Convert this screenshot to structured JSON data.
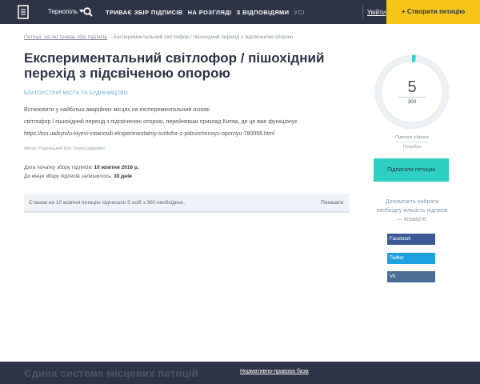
{
  "header": {
    "city": "Тернопіль",
    "nav": {
      "collecting": "ТРИВАЄ ЗБІР ПІДПИСІВ",
      "review": "НА РОЗГЛЯДІ",
      "answered": "З ВІДПОВІДЯМИ",
      "all": "УСІ"
    },
    "login": "Увійти",
    "create_petition": "+ Створити петицію"
  },
  "breadcrumb": {
    "link": "Петиції, на які триває збір підписів",
    "separator": "→",
    "current": "Експериментальний світлофор / пішохідний перехід з підсвіченою опорою"
  },
  "petition": {
    "title": "Експериментальний світлофор / пішохідний перехід з підсвіченою опорою",
    "category": "БЛАГОУСТРІЙ МІСТА ТА БУДІВНИЦТВО",
    "description_line1": "Встановити у найбільш аварійних місцях на експерементальний основі",
    "description_line2": "світлофор / пішохідний перехід з підсвіченою опорою, перейнявши приклад Києва, де це вже функціонує.",
    "description_line3": "https://tsn.ua/kyiv/u-kiyevi-vstanovili-eksperimentalniy-svitlofor-z-pidsvichenoyu-oporoyu-780058.html",
    "author": "Автор: Рудницький Ігор Олександрович",
    "start_label": "Дата початку збору підписів:",
    "start_value": "10 жовтня 2016 р.",
    "remaining_label": "До кінця збору підписів залишилось:",
    "remaining_value": "30 днів"
  },
  "status": {
    "text": "Станом на 10 жовтня петицію підписали 5 осіб з 300 необхідних.",
    "show": "Показати"
  },
  "sidebar": {
    "signatures": 5,
    "target": 300,
    "progress_percent": 1.67,
    "collected_label": "Підписів зібрано",
    "needed_label": "Потрібно",
    "sign_button": "Підписати петицію",
    "help_text": "Допоможіть набрати необхідну кількість підписів — поширте:",
    "share": {
      "facebook": "Facebook",
      "twitter": "Twitter",
      "vk": "VK"
    }
  },
  "footer": {
    "title": "Єдина система місцевих петицій",
    "link": "Нормативно-правова база"
  },
  "colors": {
    "header_bg": "#2d3445",
    "accent_yellow": "#f5c518",
    "accent_teal": "#2fcfc3",
    "gauge_track": "#eef0f3",
    "facebook": "#3b5a94",
    "twitter": "#1da1e0",
    "vk": "#4a6d94"
  },
  "icons": {
    "logo": "document-icon",
    "search": "search-icon",
    "city_dropdown": "chevron-down-icon"
  }
}
